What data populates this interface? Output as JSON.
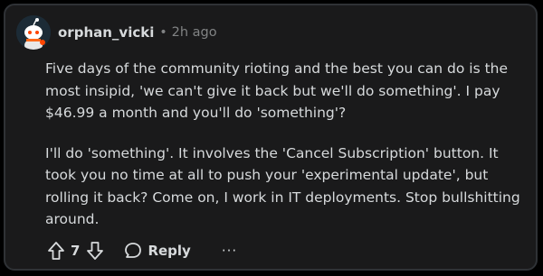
{
  "comment": {
    "author": "orphan_vicki",
    "separator": "•",
    "timestamp": "2h ago",
    "paragraphs": [
      "Five days of the community rioting and the best you can do is the most insipid, 'we can't give it back but we'll do something'. I pay $46.99 a month and you'll do 'something'?",
      "I'll do 'something'. It involves the 'Cancel Subscription' button. It took you no time at all to push your 'experimental update', but rolling it back? Come on, I work in IT deployments. Stop bullshitting around."
    ]
  },
  "actions": {
    "upvote_icon": "arrow-up-icon",
    "vote_count": "7",
    "downvote_icon": "arrow-down-icon",
    "reply_icon": "speech-bubble-icon",
    "reply_label": "Reply",
    "more_label": "···"
  },
  "colors": {
    "background": "#1a1a1b",
    "text": "#d7dadc",
    "muted": "#818384"
  }
}
